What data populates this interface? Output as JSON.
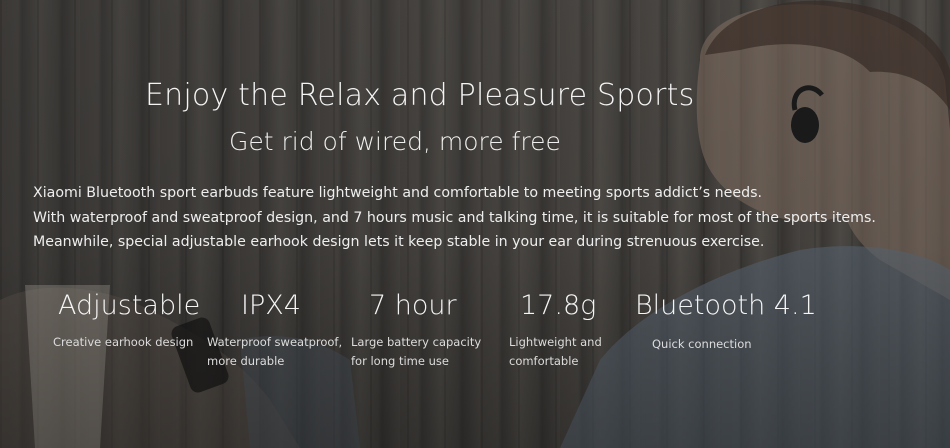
{
  "headline": "Enjoy the Relax and Pleasure Sports",
  "subheadline": "Get rid of wired, more free",
  "description": [
    "Xiaomi Bluetooth sport earbuds feature lightweight and comfortable to meeting sports addict’s needs.",
    "With waterproof and sweatproof design, and 7 hours music and talking time, it is suitable for most of the sports items.",
    "Meanwhile, special adjustable earhook design lets it keep stable in your ear during strenuous exercise."
  ],
  "features": [
    {
      "value": "Adjustable",
      "caption_lines": [
        "Creative earhook design"
      ]
    },
    {
      "value": "IPX4",
      "caption_lines": [
        "Waterproof sweatproof,",
        "more durable"
      ]
    },
    {
      "value": "7 hour",
      "caption_lines": [
        "Large battery capacity",
        "for long time use"
      ]
    },
    {
      "value": "17.8g",
      "caption_lines": [
        "Lightweight and",
        "comfortable"
      ]
    },
    {
      "value": "Bluetooth 4.1",
      "caption_lines": [
        "Quick connection"
      ]
    }
  ]
}
